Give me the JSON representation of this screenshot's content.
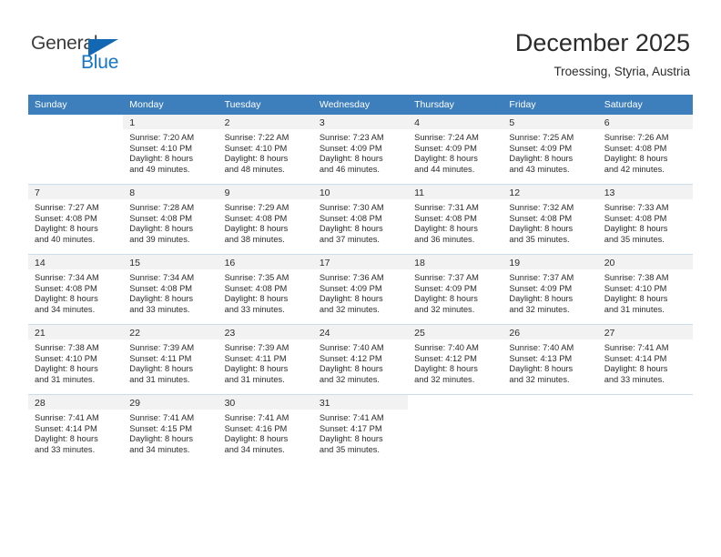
{
  "branding": {
    "logo_text_primary": "General",
    "logo_text_secondary": "Blue",
    "logo_mark": "triangle-flag-icon",
    "accent_color": "#1368b4"
  },
  "header": {
    "month_title": "December 2025",
    "location": "Troessing, Styria, Austria"
  },
  "calendar": {
    "header_bg": "#3d7ebd",
    "daynum_bg": "#f2f2f2",
    "weekday_headers": [
      "Sunday",
      "Monday",
      "Tuesday",
      "Wednesday",
      "Thursday",
      "Friday",
      "Saturday"
    ],
    "weeks": [
      [
        {
          "day": "",
          "sunrise": "",
          "sunset": "",
          "daylight_line1": "",
          "daylight_line2": ""
        },
        {
          "day": "1",
          "sunrise": "Sunrise: 7:20 AM",
          "sunset": "Sunset: 4:10 PM",
          "daylight_line1": "Daylight: 8 hours",
          "daylight_line2": "and 49 minutes."
        },
        {
          "day": "2",
          "sunrise": "Sunrise: 7:22 AM",
          "sunset": "Sunset: 4:10 PM",
          "daylight_line1": "Daylight: 8 hours",
          "daylight_line2": "and 48 minutes."
        },
        {
          "day": "3",
          "sunrise": "Sunrise: 7:23 AM",
          "sunset": "Sunset: 4:09 PM",
          "daylight_line1": "Daylight: 8 hours",
          "daylight_line2": "and 46 minutes."
        },
        {
          "day": "4",
          "sunrise": "Sunrise: 7:24 AM",
          "sunset": "Sunset: 4:09 PM",
          "daylight_line1": "Daylight: 8 hours",
          "daylight_line2": "and 44 minutes."
        },
        {
          "day": "5",
          "sunrise": "Sunrise: 7:25 AM",
          "sunset": "Sunset: 4:09 PM",
          "daylight_line1": "Daylight: 8 hours",
          "daylight_line2": "and 43 minutes."
        },
        {
          "day": "6",
          "sunrise": "Sunrise: 7:26 AM",
          "sunset": "Sunset: 4:08 PM",
          "daylight_line1": "Daylight: 8 hours",
          "daylight_line2": "and 42 minutes."
        }
      ],
      [
        {
          "day": "7",
          "sunrise": "Sunrise: 7:27 AM",
          "sunset": "Sunset: 4:08 PM",
          "daylight_line1": "Daylight: 8 hours",
          "daylight_line2": "and 40 minutes."
        },
        {
          "day": "8",
          "sunrise": "Sunrise: 7:28 AM",
          "sunset": "Sunset: 4:08 PM",
          "daylight_line1": "Daylight: 8 hours",
          "daylight_line2": "and 39 minutes."
        },
        {
          "day": "9",
          "sunrise": "Sunrise: 7:29 AM",
          "sunset": "Sunset: 4:08 PM",
          "daylight_line1": "Daylight: 8 hours",
          "daylight_line2": "and 38 minutes."
        },
        {
          "day": "10",
          "sunrise": "Sunrise: 7:30 AM",
          "sunset": "Sunset: 4:08 PM",
          "daylight_line1": "Daylight: 8 hours",
          "daylight_line2": "and 37 minutes."
        },
        {
          "day": "11",
          "sunrise": "Sunrise: 7:31 AM",
          "sunset": "Sunset: 4:08 PM",
          "daylight_line1": "Daylight: 8 hours",
          "daylight_line2": "and 36 minutes."
        },
        {
          "day": "12",
          "sunrise": "Sunrise: 7:32 AM",
          "sunset": "Sunset: 4:08 PM",
          "daylight_line1": "Daylight: 8 hours",
          "daylight_line2": "and 35 minutes."
        },
        {
          "day": "13",
          "sunrise": "Sunrise: 7:33 AM",
          "sunset": "Sunset: 4:08 PM",
          "daylight_line1": "Daylight: 8 hours",
          "daylight_line2": "and 35 minutes."
        }
      ],
      [
        {
          "day": "14",
          "sunrise": "Sunrise: 7:34 AM",
          "sunset": "Sunset: 4:08 PM",
          "daylight_line1": "Daylight: 8 hours",
          "daylight_line2": "and 34 minutes."
        },
        {
          "day": "15",
          "sunrise": "Sunrise: 7:34 AM",
          "sunset": "Sunset: 4:08 PM",
          "daylight_line1": "Daylight: 8 hours",
          "daylight_line2": "and 33 minutes."
        },
        {
          "day": "16",
          "sunrise": "Sunrise: 7:35 AM",
          "sunset": "Sunset: 4:08 PM",
          "daylight_line1": "Daylight: 8 hours",
          "daylight_line2": "and 33 minutes."
        },
        {
          "day": "17",
          "sunrise": "Sunrise: 7:36 AM",
          "sunset": "Sunset: 4:09 PM",
          "daylight_line1": "Daylight: 8 hours",
          "daylight_line2": "and 32 minutes."
        },
        {
          "day": "18",
          "sunrise": "Sunrise: 7:37 AM",
          "sunset": "Sunset: 4:09 PM",
          "daylight_line1": "Daylight: 8 hours",
          "daylight_line2": "and 32 minutes."
        },
        {
          "day": "19",
          "sunrise": "Sunrise: 7:37 AM",
          "sunset": "Sunset: 4:09 PM",
          "daylight_line1": "Daylight: 8 hours",
          "daylight_line2": "and 32 minutes."
        },
        {
          "day": "20",
          "sunrise": "Sunrise: 7:38 AM",
          "sunset": "Sunset: 4:10 PM",
          "daylight_line1": "Daylight: 8 hours",
          "daylight_line2": "and 31 minutes."
        }
      ],
      [
        {
          "day": "21",
          "sunrise": "Sunrise: 7:38 AM",
          "sunset": "Sunset: 4:10 PM",
          "daylight_line1": "Daylight: 8 hours",
          "daylight_line2": "and 31 minutes."
        },
        {
          "day": "22",
          "sunrise": "Sunrise: 7:39 AM",
          "sunset": "Sunset: 4:11 PM",
          "daylight_line1": "Daylight: 8 hours",
          "daylight_line2": "and 31 minutes."
        },
        {
          "day": "23",
          "sunrise": "Sunrise: 7:39 AM",
          "sunset": "Sunset: 4:11 PM",
          "daylight_line1": "Daylight: 8 hours",
          "daylight_line2": "and 31 minutes."
        },
        {
          "day": "24",
          "sunrise": "Sunrise: 7:40 AM",
          "sunset": "Sunset: 4:12 PM",
          "daylight_line1": "Daylight: 8 hours",
          "daylight_line2": "and 32 minutes."
        },
        {
          "day": "25",
          "sunrise": "Sunrise: 7:40 AM",
          "sunset": "Sunset: 4:12 PM",
          "daylight_line1": "Daylight: 8 hours",
          "daylight_line2": "and 32 minutes."
        },
        {
          "day": "26",
          "sunrise": "Sunrise: 7:40 AM",
          "sunset": "Sunset: 4:13 PM",
          "daylight_line1": "Daylight: 8 hours",
          "daylight_line2": "and 32 minutes."
        },
        {
          "day": "27",
          "sunrise": "Sunrise: 7:41 AM",
          "sunset": "Sunset: 4:14 PM",
          "daylight_line1": "Daylight: 8 hours",
          "daylight_line2": "and 33 minutes."
        }
      ],
      [
        {
          "day": "28",
          "sunrise": "Sunrise: 7:41 AM",
          "sunset": "Sunset: 4:14 PM",
          "daylight_line1": "Daylight: 8 hours",
          "daylight_line2": "and 33 minutes."
        },
        {
          "day": "29",
          "sunrise": "Sunrise: 7:41 AM",
          "sunset": "Sunset: 4:15 PM",
          "daylight_line1": "Daylight: 8 hours",
          "daylight_line2": "and 34 minutes."
        },
        {
          "day": "30",
          "sunrise": "Sunrise: 7:41 AM",
          "sunset": "Sunset: 4:16 PM",
          "daylight_line1": "Daylight: 8 hours",
          "daylight_line2": "and 34 minutes."
        },
        {
          "day": "31",
          "sunrise": "Sunrise: 7:41 AM",
          "sunset": "Sunset: 4:17 PM",
          "daylight_line1": "Daylight: 8 hours",
          "daylight_line2": "and 35 minutes."
        },
        {
          "day": "",
          "sunrise": "",
          "sunset": "",
          "daylight_line1": "",
          "daylight_line2": ""
        },
        {
          "day": "",
          "sunrise": "",
          "sunset": "",
          "daylight_line1": "",
          "daylight_line2": ""
        },
        {
          "day": "",
          "sunrise": "",
          "sunset": "",
          "daylight_line1": "",
          "daylight_line2": ""
        }
      ]
    ]
  }
}
